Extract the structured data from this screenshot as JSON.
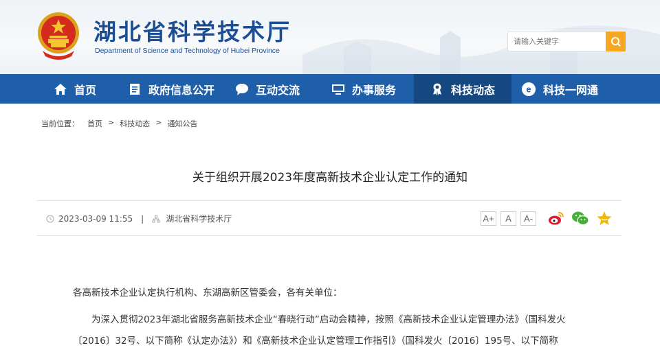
{
  "header": {
    "title": "湖北省科学技术厅",
    "subtitle": "Department of Science and Technology of Hubei Province",
    "search_placeholder": "请输入关键字"
  },
  "nav": [
    {
      "label": "首页",
      "icon": "home-icon"
    },
    {
      "label": "政府信息公开",
      "icon": "document-icon"
    },
    {
      "label": "互动交流",
      "icon": "chat-bubble-icon"
    },
    {
      "label": "办事服务",
      "icon": "monitor-icon"
    },
    {
      "label": "科技动态",
      "icon": "award-icon",
      "active": true
    },
    {
      "label": "科技一网通",
      "icon": "e-circle-icon"
    }
  ],
  "breadcrumb": {
    "prefix": "当前位置：",
    "items": [
      "首页",
      "科技动态",
      "通知公告"
    ],
    "separator": ">"
  },
  "article": {
    "title": "关于组织开展2023年度高新技术企业认定工作的通知",
    "datetime": "2023-03-09 11:55",
    "meta_separator": "|",
    "source": "湖北省科学技术厅",
    "font_buttons": [
      "A+",
      "A",
      "A-"
    ],
    "share_icons": [
      "weibo-icon",
      "wechat-icon",
      "favorite-icon"
    ],
    "salutation": "各高新技术企业认定执行机构、东湖高新区管委会，各有关单位：",
    "paragraph1": "为深入贯彻2023年湖北省服务高新技术企业“春晓行动”启动会精神，按照《高新技术企业认定管理办法》（国科发火〔2016〕32号、以下简称《认定办法》）和《高新技术企业认定管理工作指引》（国科发火〔2016〕195号、以下简称"
  },
  "colors": {
    "nav_bg": "#1f5faa",
    "nav_active": "#154781",
    "title_blue": "#1b4e95",
    "search_button": "#f5a623"
  }
}
